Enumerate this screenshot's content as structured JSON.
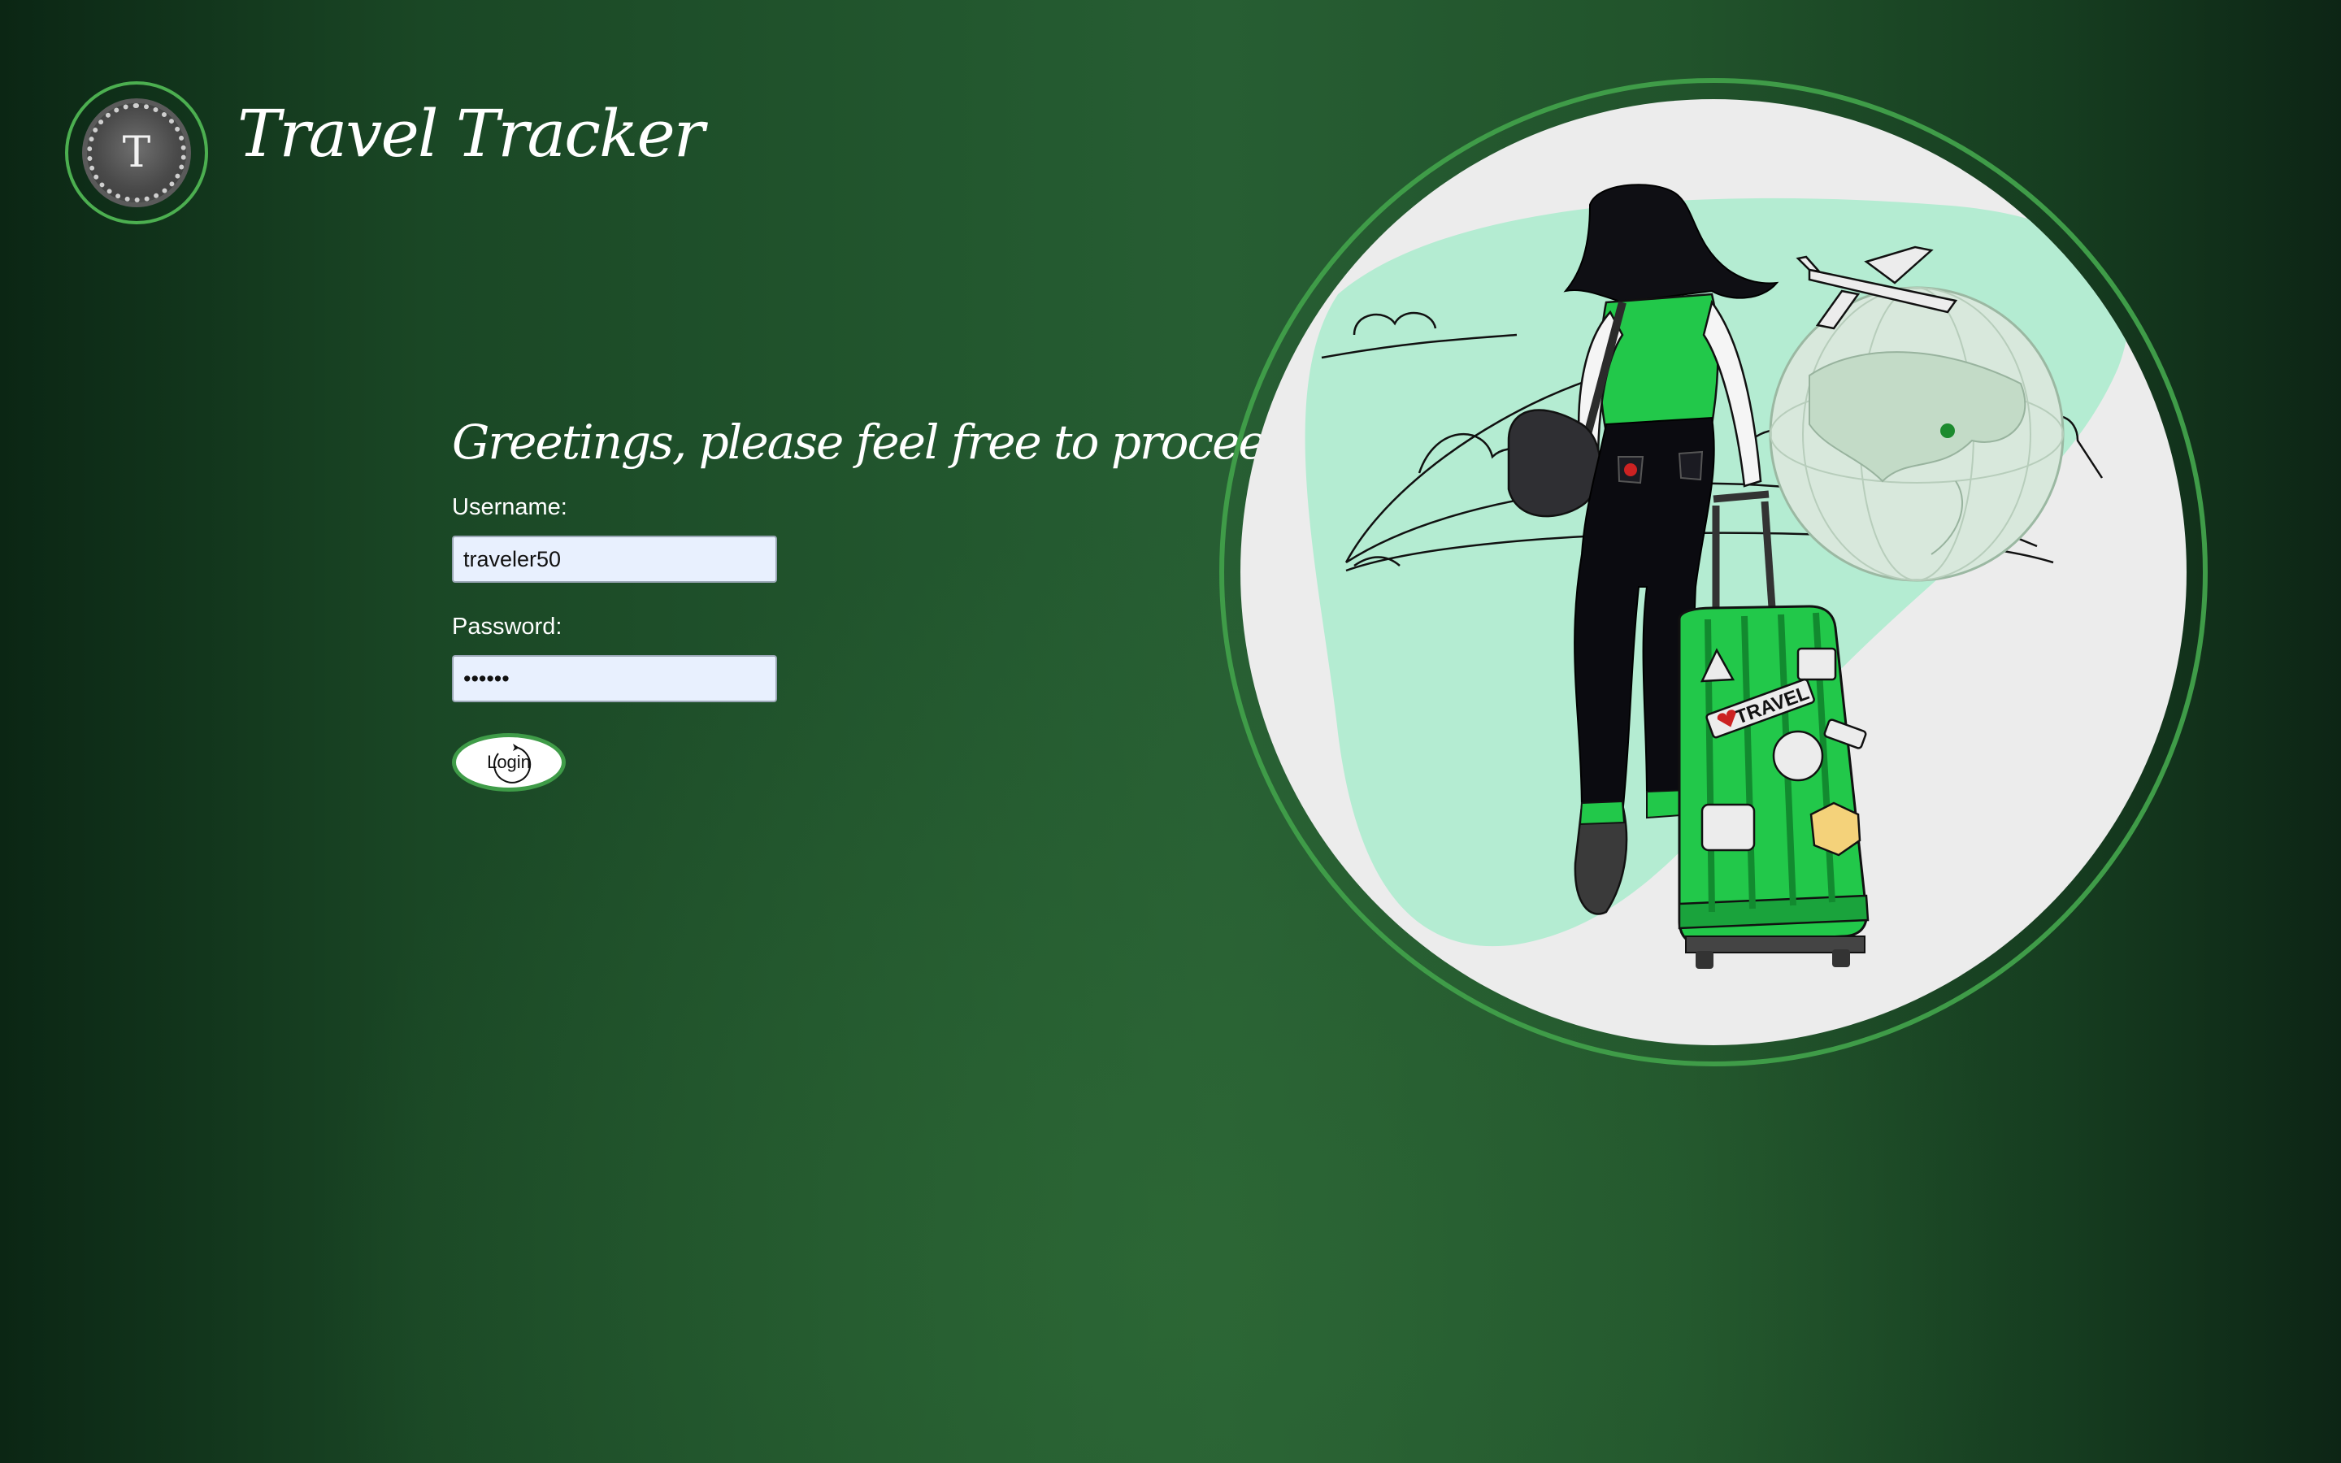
{
  "header": {
    "logo_letter": "T",
    "app_title": "Travel Tracker"
  },
  "login": {
    "greeting": "Greetings, please feel free to proceed.",
    "username_label": "Username:",
    "username_value": "traveler50",
    "password_label": "Password:",
    "password_value": "••••••",
    "login_button_label": "Login"
  },
  "illustration": {
    "sticker_text": "TRAVEL",
    "icons": [
      "traveler-illustration",
      "globe-icon",
      "airplane-icon",
      "suitcase-icon"
    ]
  },
  "colors": {
    "brand_green": "#3f9c48",
    "accent_green": "#22c84a",
    "mint": "#b4ecd2"
  }
}
